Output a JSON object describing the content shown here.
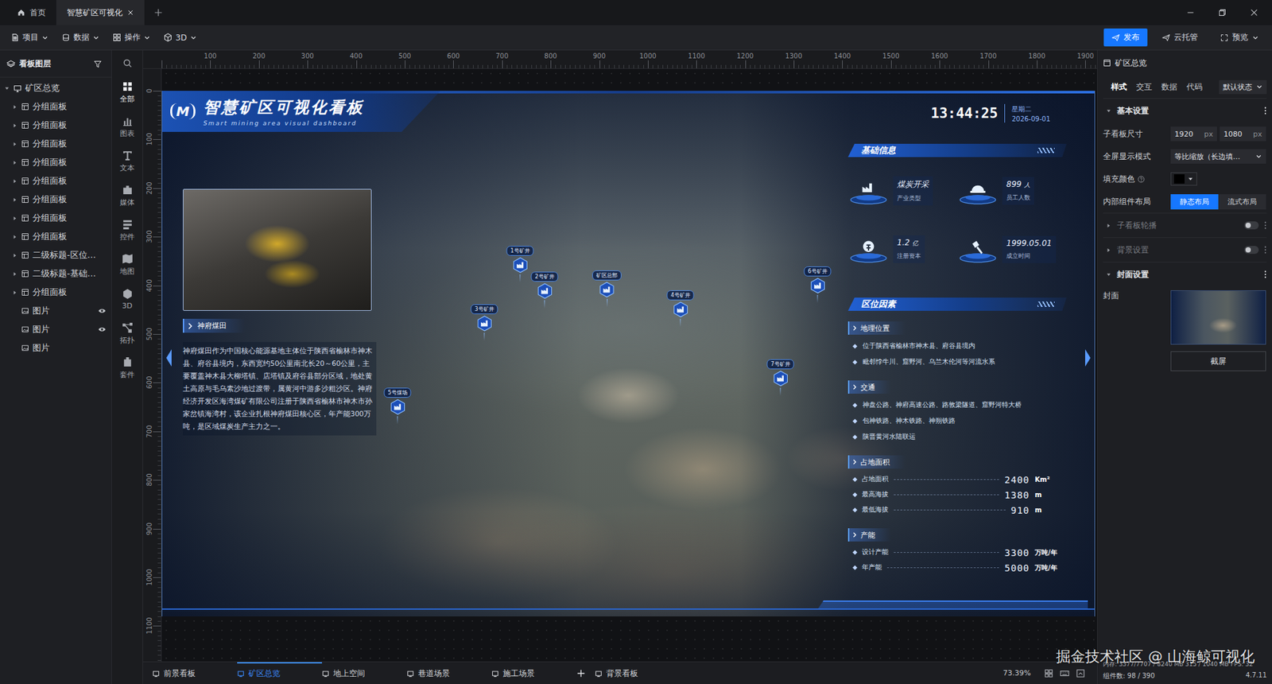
{
  "window": {
    "tabs": [
      {
        "label": "首页",
        "selected": false,
        "closable": false
      },
      {
        "label": "智慧矿区可视化",
        "selected": true,
        "closable": true
      }
    ]
  },
  "toolbar": {
    "menus": [
      "项目",
      "数据",
      "操作",
      "3D"
    ],
    "actions": [
      {
        "label": "发布",
        "primary": true
      },
      {
        "label": "云托管",
        "primary": false
      },
      {
        "label": "预览",
        "primary": false
      }
    ]
  },
  "layers": {
    "title": "看板图层",
    "root": {
      "label": "矿区总览",
      "expanded": true
    },
    "items": [
      {
        "label": "分组面板",
        "kind": "group",
        "hidden": false
      },
      {
        "label": "分组面板",
        "kind": "group",
        "hidden": false
      },
      {
        "label": "分组面板",
        "kind": "group",
        "hidden": false
      },
      {
        "label": "分组面板",
        "kind": "group",
        "hidden": false
      },
      {
        "label": "分组面板",
        "kind": "group",
        "hidden": false
      },
      {
        "label": "分组面板",
        "kind": "group",
        "hidden": false
      },
      {
        "label": "分组面板",
        "kind": "group",
        "hidden": false
      },
      {
        "label": "分组面板",
        "kind": "group",
        "hidden": false
      },
      {
        "label": "二级标题-区位…",
        "kind": "group",
        "hidden": false
      },
      {
        "label": "二级标题-基础…",
        "kind": "group",
        "hidden": false
      },
      {
        "label": "分组面板",
        "kind": "group",
        "hidden": false
      },
      {
        "label": "图片",
        "kind": "image",
        "hidden": true
      },
      {
        "label": "图片",
        "kind": "image",
        "hidden": true
      },
      {
        "label": "图片",
        "kind": "image",
        "hidden": false
      }
    ]
  },
  "components": [
    {
      "label": "全部",
      "selected": true
    },
    {
      "label": "图表",
      "selected": false
    },
    {
      "label": "文本",
      "selected": false
    },
    {
      "label": "媒体",
      "selected": false
    },
    {
      "label": "控件",
      "selected": false
    },
    {
      "label": "地图",
      "selected": false
    },
    {
      "label": "3D",
      "selected": false
    },
    {
      "label": "拓扑",
      "selected": false
    },
    {
      "label": "套件",
      "selected": false
    }
  ],
  "editor": {
    "ruler_x": [
      "100",
      "200",
      "300",
      "400",
      "500",
      "600",
      "700",
      "800",
      "900",
      "1000",
      "1100",
      "1200",
      "1300",
      "1400",
      "1500",
      "1600",
      "1700",
      "1800",
      "1900"
    ],
    "ruler_y": [
      "0",
      "100",
      "200",
      "300",
      "400",
      "500",
      "600",
      "700",
      "800",
      "900",
      "1000",
      "1100"
    ]
  },
  "dashboard": {
    "logo": "M",
    "title": "智慧矿区可视化看板",
    "subtitle": "Smart mining area visual dashboard",
    "time": "13:44:25",
    "weekday": "星期二",
    "date": "2026-09-01",
    "caption": "神府煤田",
    "description": "神府煤田作为中国核心能源基地主体位于陕西省榆林市神木县、府谷县境内，东西宽约50公里南北长20～60公里，主要覆盖神木县大柳塔镇、店塔镇及府谷县部分区域，地处黄土高原与毛乌素沙地过渡带，属黄河中游多沙粗沙区。神府经济开发区海湾煤矿有限公司注册于陕西省榆林市神木市孙家岔镇海湾村，该企业扎根神府煤田核心区，年产能300万吨，是区域煤炭生产主力之一。",
    "basic_info": {
      "title": "基础信息",
      "items": [
        {
          "value": "煤炭开采",
          "unit": "",
          "label": "产业类型"
        },
        {
          "value": "899",
          "unit": "人",
          "label": "员工人数"
        },
        {
          "value": "1.2",
          "unit": "亿",
          "label": "注册资本"
        },
        {
          "value": "1999.05.01",
          "unit": "",
          "label": "成立时间"
        }
      ]
    },
    "location": {
      "title": "区位因素",
      "sections": [
        {
          "title": "地理位置",
          "kind": "list",
          "lines": [
            "位于陕西省榆林市神木县、府谷县境内",
            "毗邻悖牛川、窟野河、乌兰木伦河等河流水系"
          ]
        },
        {
          "title": "交通",
          "kind": "list",
          "lines": [
            "神盘公路、神府高速公路、路敦梁隧道、窟野河特大桥",
            "包神铁路、神木铁路、神朔铁路",
            "陕晋黄河水陆联运"
          ]
        },
        {
          "title": "占地面积",
          "kind": "stats",
          "rows": [
            {
              "label": "占地面积",
              "value": "2400",
              "unit": "Km²"
            },
            {
              "label": "最高海拔",
              "value": "1380",
              "unit": "m"
            },
            {
              "label": "最低海拔",
              "value": "910",
              "unit": "m"
            }
          ]
        },
        {
          "title": "产能",
          "kind": "stats",
          "rows": [
            {
              "label": "设计产能",
              "value": "3300",
              "unit": "万吨/年"
            },
            {
              "label": "年产能",
              "value": "5000",
              "unit": "万吨/年"
            }
          ]
        }
      ]
    },
    "pins": [
      {
        "label": "1号矿井"
      },
      {
        "label": "2号矿井"
      },
      {
        "label": "矿区总部"
      },
      {
        "label": "3号矿井"
      },
      {
        "label": "4号矿井"
      },
      {
        "label": "6号矿井"
      },
      {
        "label": "7号矿井"
      },
      {
        "label": "5号煤场"
      }
    ]
  },
  "properties": {
    "title": "矿区总览",
    "tabs": [
      {
        "label": "样式",
        "selected": true
      },
      {
        "label": "交互",
        "selected": false
      },
      {
        "label": "数据",
        "selected": false
      },
      {
        "label": "代码",
        "selected": false
      }
    ],
    "state": "默认状态",
    "basic": {
      "title": "基本设置",
      "expanded": true,
      "size_label": "子看板尺寸",
      "width": "1920",
      "height": "1080",
      "unit": "px",
      "fullscreen_label": "全屏显示模式",
      "fullscreen_value": "等比缩放（长边填…",
      "fill_label": "填充颜色",
      "fill_color": "#000000",
      "layout_label": "内部组件布局",
      "layout_options": [
        {
          "label": "静态布局",
          "selected": true
        },
        {
          "label": "流式布局",
          "selected": false
        }
      ]
    },
    "toggles": [
      {
        "title": "子看板轮播",
        "expanded": false,
        "on": false,
        "disabled": true
      },
      {
        "title": "背景设置",
        "expanded": false,
        "on": false,
        "disabled": true
      }
    ],
    "cover": {
      "title": "封面设置",
      "expanded": true,
      "label": "封面",
      "button": "截屏"
    }
  },
  "scenes": {
    "items": [
      {
        "label": "前景看板",
        "selected": false
      },
      {
        "label": "矿区总览",
        "selected": true
      },
      {
        "label": "地上空间",
        "selected": false
      },
      {
        "label": "巷道场景",
        "selected": false
      },
      {
        "label": "施工场景",
        "selected": false
      }
    ],
    "background_label": "背景看板"
  },
  "status": {
    "zoom": "73.39%",
    "memory": "内存: 3377/7707 / 8240 MB 315 / 1040 MB FPS: 32",
    "components": "组件数: 98 / 390",
    "version": "4.7.11"
  },
  "watermark": "掘金技术社区 @ 山海鲸可视化"
}
